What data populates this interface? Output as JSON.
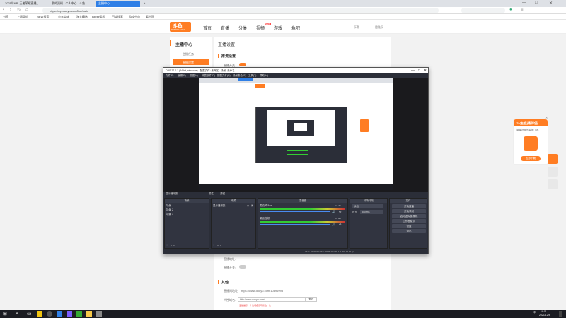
{
  "browser": {
    "tabs": [
      {
        "label": "2021年KPL王者荣耀直播_"
      },
      {
        "label": "我的资料 - 个人中心 - 斗鱼"
      },
      {
        "label": "主播中心"
      }
    ],
    "url": "https://mp.douyu.com/live/main",
    "bookmarks": [
      "书签",
      "上网导航",
      "NEW搜索",
      "京东商城",
      "淘宝精选",
      "Bilibili娱乐",
      "百度搜索",
      "游戏中心",
      "看中国"
    ],
    "window_controls": {
      "min": "—",
      "max": "□",
      "close": "✕"
    },
    "new_tab": "+"
  },
  "site": {
    "logo_text": "斗鱼",
    "logo_sub": "DOUYU.COM",
    "nav": [
      "首页",
      "直播",
      "分类",
      "视频",
      "游戏",
      "鱼吧"
    ],
    "nav_badge": "NEW",
    "right_links": [
      "下载",
      "登陆下"
    ]
  },
  "leftmenu": {
    "title": "主播中心",
    "items": [
      "主播任务",
      "直播设置"
    ]
  },
  "main": {
    "heading": "直播设置",
    "section1": "推流设置",
    "toggle_label": "直播开关",
    "lower_label1": "直播地址:",
    "lower_label2": "直播开关:",
    "section2": "其他",
    "room_label": "直播间地址:",
    "room_url": "https://www.douyu.com/10896998",
    "domain_label": "个性域名:",
    "domain_value": "http://www.douyu.com/",
    "domain_btn": "修改",
    "domain_hint": "温馨提示：个性域名仅可修改一次"
  },
  "obs": {
    "title": "OBS 27.0.1 (64-bit, windows) - 配置文件: 未命名 - 场景: 未命名",
    "menu": [
      "文件(F)",
      "编辑(E)",
      "视图(V)",
      "停靠部件(D)",
      "配置文件(P)",
      "场景集合(S)",
      "工具(T)",
      "帮助(H)"
    ],
    "preview_controls": [
      "属性",
      "滤镜"
    ],
    "source_status": "显示器采集",
    "docks": {
      "scenes": {
        "title": "场景",
        "items": [
          "场景",
          "场景 2",
          "场景 3"
        ]
      },
      "sources": {
        "title": "来源",
        "items": [
          "显示器采集"
        ]
      },
      "mixer": {
        "title": "混音器",
        "tracks": [
          {
            "name": "麦克风/Aux",
            "db": "0.0 dB"
          },
          {
            "name": "桌面音频",
            "db": "0.0 dB"
          }
        ]
      },
      "transitions": {
        "title": "转场特效",
        "type": "淡出",
        "duration_label": "时长",
        "duration": "300 ms"
      },
      "controls": {
        "title": "控件",
        "buttons": [
          "开始直播",
          "开始录制",
          "启动虚拟摄像机",
          "工作室模式",
          "设置",
          "退出"
        ]
      }
    },
    "statusbar": "LIVE: 00:00:00   REC: 00:00:00   CPU: 2.3%, 30.00 fps",
    "scene_label": "场景",
    "bottom_buttons": "+ − ∧ ∨"
  },
  "promo": {
    "title": "斗鱼直播伴侣",
    "desc": "简单好用的直播工具",
    "btn": "立即下载"
  },
  "taskbar": {
    "time": "19:01",
    "date": "2021/12/8",
    "lang": "中"
  },
  "colors": {
    "accent": "#ff7d23",
    "browser_tab": "#2f7fe6",
    "obs_bg": "#2b2e38"
  }
}
